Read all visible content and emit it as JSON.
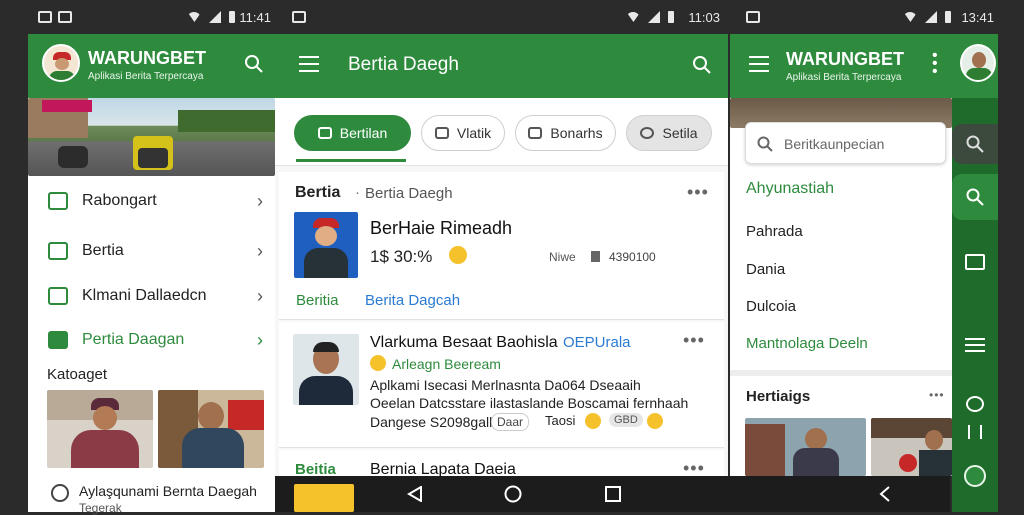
{
  "status_left": {
    "time": "11:41"
  },
  "status_mid": {
    "time": "11:03"
  },
  "status_right": {
    "time": "13:41"
  },
  "left_drawer": {
    "app_title": "WARUNGBET",
    "app_subtitle": "Aplikasi Berita Terpercaya",
    "items": [
      {
        "label": "Rabongart",
        "icon": "home-icon"
      },
      {
        "label": "Bertia",
        "icon": "news-icon"
      },
      {
        "label": "Klmani Dallaedcn",
        "icon": "calendar-icon"
      },
      {
        "label": "Pertia Daagan",
        "icon": "tag-icon",
        "active": true
      }
    ],
    "section_label": "Katoaget",
    "bottom_item": "Aylaşqunami Bernta Daegah",
    "bottom_item_sub": "Tegerak"
  },
  "center": {
    "header_title": "Bertia Daegh",
    "chips": [
      "Bertilan",
      "Vlatik",
      "Bonarhs",
      "Setila"
    ],
    "post1": {
      "source": "Bertia",
      "separator": "·",
      "source_sub": "Bertia Daegh",
      "title": "BerHaie Rimeadh",
      "meta_left": "1$ 30:%",
      "meta_right_label": "Niwe",
      "meta_right_value": "4390100",
      "tag1": "Beritia",
      "tag2": "Berita Dagcah"
    },
    "post2": {
      "title": "Vlarkuma Besaat Baohisla",
      "badge": "OEPUrala",
      "subtitle": "Arleagn Beeream",
      "line1": "Aplkami Isecasi Merlnasnta Da064 Dseaaih",
      "line2": "Oeelan Datcsstare ilastaslande Boscamai fernhaah",
      "line3": "Dangese S2098gall",
      "reaction1": "Daar",
      "reaction2": "Taosi",
      "reaction3": "GBD"
    },
    "post3": {
      "source": "Beitia",
      "title": "Bernia Lapata Daeia"
    }
  },
  "right_panel": {
    "app_title": "WARUNGBET",
    "app_subtitle": "Aplikasi Berita Terpercaya",
    "search_placeholder": "Beritkaunpecian",
    "active_item": "Ahyunastiah",
    "items": [
      "Pahrada",
      "Dania",
      "Dulcoia"
    ],
    "highlight_item": "Mantnolaga Deeln",
    "section_label": "Hertiaigs",
    "more_dots": "•••"
  },
  "colors": {
    "brand_green": "#2e8b3e",
    "dark_green": "#1f6b2c",
    "link_blue": "#2a7bd3"
  }
}
